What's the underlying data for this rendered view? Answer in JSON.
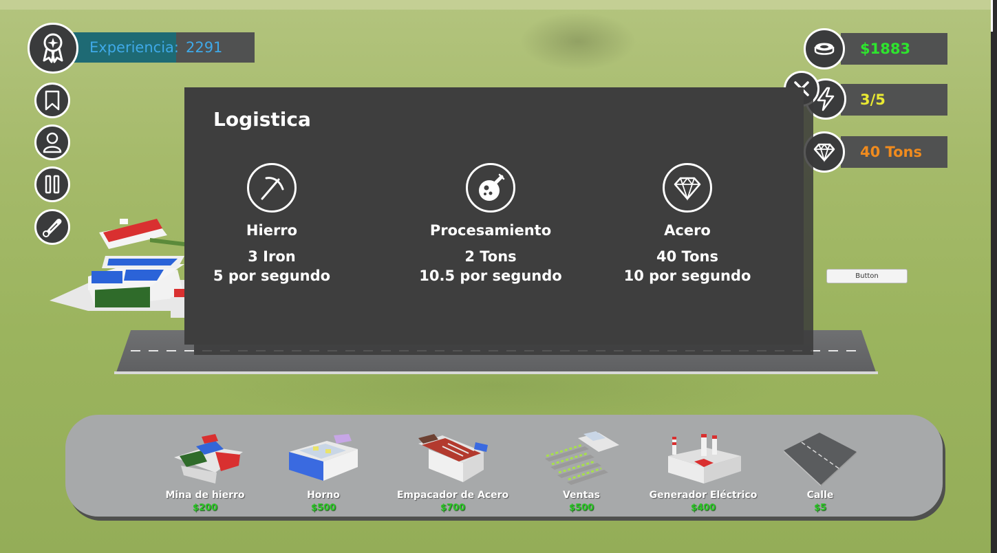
{
  "hud": {
    "experience_label": "Experiencia:",
    "experience_value": "2291",
    "experience_progress": 0.59,
    "money": "$1883",
    "energy": "3/5",
    "steel": "40 Tons"
  },
  "modal": {
    "title": "Logistica",
    "columns": [
      {
        "name": "Hierro",
        "line1": "3 Iron",
        "line2": "5 por segundo",
        "icon": "pickaxe-icon"
      },
      {
        "name": "Procesamiento",
        "line1": "2 Tons",
        "line2": "10.5 por segundo",
        "icon": "flask-icon"
      },
      {
        "name": "Acero",
        "line1": "40 Tons",
        "line2": "10 por segundo",
        "icon": "diamond-icon"
      }
    ]
  },
  "unity_button": "Button",
  "shop": {
    "items": [
      {
        "name": "Mina de hierro",
        "price": "$200"
      },
      {
        "name": "Horno",
        "price": "$500"
      },
      {
        "name": "Empacador de Acero",
        "price": "$700"
      },
      {
        "name": "Ventas",
        "price": "$500"
      },
      {
        "name": "Generador Eléctrico",
        "price": "$400"
      },
      {
        "name": "Calle",
        "price": "$5"
      }
    ]
  },
  "colors": {
    "money": "#2ee52e",
    "energy": "#e9e933",
    "steel": "#f08b1e",
    "experience": "#3fa9e8"
  }
}
